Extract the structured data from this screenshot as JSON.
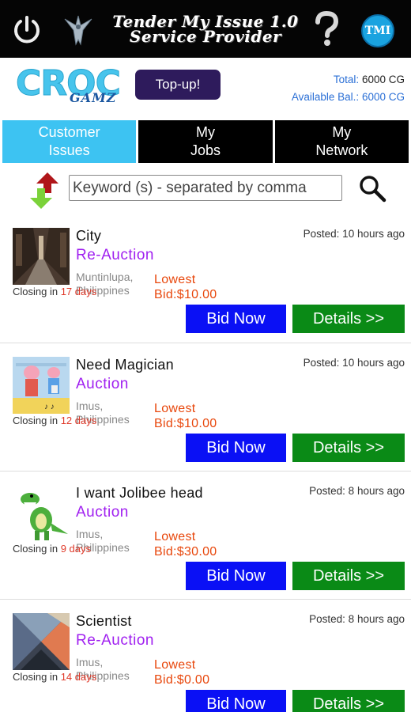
{
  "header": {
    "title_line1": "Tender My Issue 1.0",
    "title_line2": "Service Provider",
    "tmi_badge": "TMI",
    "icons": [
      "power-icon",
      "bird-logo-icon",
      "question-icon",
      "tmi-badge-icon"
    ]
  },
  "brand": {
    "logo_main": "CROC",
    "logo_sub": "GAMZ"
  },
  "topup_label": "Top-up!",
  "balance": {
    "total_label": "Total:",
    "total_value": "6000 CG",
    "available_label": "Available Bal.:",
    "available_value": "6000 CG"
  },
  "tabs": [
    {
      "line1": "Customer",
      "line2": "Issues",
      "active": true
    },
    {
      "line1": "My",
      "line2": "Jobs",
      "active": false
    },
    {
      "line1": "My",
      "line2": "Network",
      "active": false
    }
  ],
  "search": {
    "placeholder": "Keyword (s) - separated by comma",
    "sort_icon": "sort-arrows-icon",
    "search_icon": "magnifier-icon"
  },
  "colors": {
    "tab_active": "#3dc3f2",
    "auction": "#a020f0",
    "bid_button": "#0a10f5",
    "details_button": "#0a8a16",
    "bid_text": "#e8470c"
  },
  "items": [
    {
      "title": "City",
      "type": "Re-Auction",
      "posted": "Posted: 10 hours ago",
      "loc1": "Muntinlupa,",
      "loc2": "Philippines",
      "closing_prefix": "Closing in ",
      "closing_days": "17 days",
      "bid1": "Lowest",
      "bid2": "Bid:$10.00",
      "bid_button": "Bid Now",
      "details_button": "Details >>",
      "thumb": "city-street-photo"
    },
    {
      "title": "Need Magician",
      "type": "Auction",
      "posted": "Posted: 10 hours ago",
      "loc1": "Imus,",
      "loc2": "Philippines",
      "closing_prefix": "Closing in ",
      "closing_days": "12 days",
      "bid1": "Lowest",
      "bid2": "Bid:$10.00",
      "bid_button": "Bid Now",
      "details_button": "Details >>",
      "thumb": "cartoon-pig-image"
    },
    {
      "title": "I want Jolibee head",
      "type": "Auction",
      "posted": "Posted: 8 hours ago",
      "loc1": "Imus,",
      "loc2": "Philippines",
      "closing_prefix": "Closing in ",
      "closing_days": "9 days",
      "bid1": "Lowest",
      "bid2": "Bid:$30.00",
      "bid_button": "Bid Now",
      "details_button": "Details >>",
      "thumb": "green-dinosaur-image"
    },
    {
      "title": "Scientist",
      "type": "Re-Auction",
      "posted": "Posted: 8 hours ago",
      "loc1": "Imus,",
      "loc2": "Philippines",
      "closing_prefix": "Closing in ",
      "closing_days": "14 days",
      "bid1": "Lowest",
      "bid2": "Bid:$0.00",
      "bid_button": "Bid Now",
      "details_button": "Details >>",
      "thumb": "abstract-geometric-image"
    }
  ]
}
